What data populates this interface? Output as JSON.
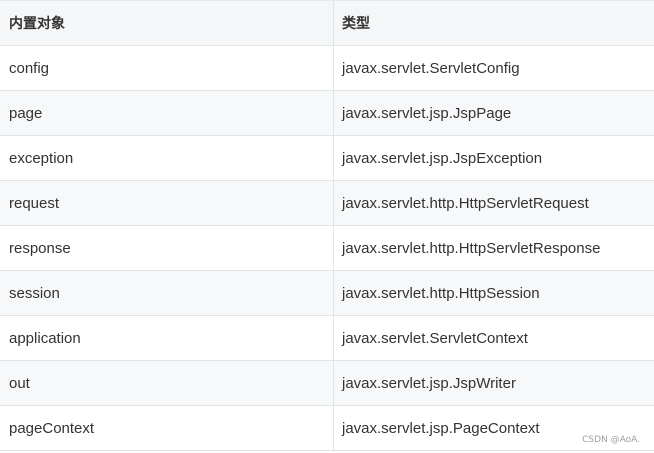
{
  "table": {
    "headers": [
      "内置对象",
      "类型"
    ],
    "rows": [
      {
        "name": "config",
        "type": "javax.servlet.ServletConfig"
      },
      {
        "name": "page",
        "type": "javax.servlet.jsp.JspPage"
      },
      {
        "name": "exception",
        "type": "javax.servlet.jsp.JspException"
      },
      {
        "name": "request",
        "type": "javax.servlet.http.HttpServletRequest"
      },
      {
        "name": "response",
        "type": "javax.servlet.http.HttpServletResponse"
      },
      {
        "name": "session",
        "type": "javax.servlet.http.HttpSession"
      },
      {
        "name": "application",
        "type": "javax.servlet.ServletContext"
      },
      {
        "name": "out",
        "type": "javax.servlet.jsp.JspWriter"
      },
      {
        "name": "pageContext",
        "type": "javax.servlet.jsp.PageContext"
      }
    ]
  },
  "watermark": "CSDN @AoA.",
  "colors": {
    "header_bg": "#f5f6f7",
    "alt_row_bg": "#f7f8f9",
    "border": "#e2e5e8",
    "text": "#333333"
  }
}
